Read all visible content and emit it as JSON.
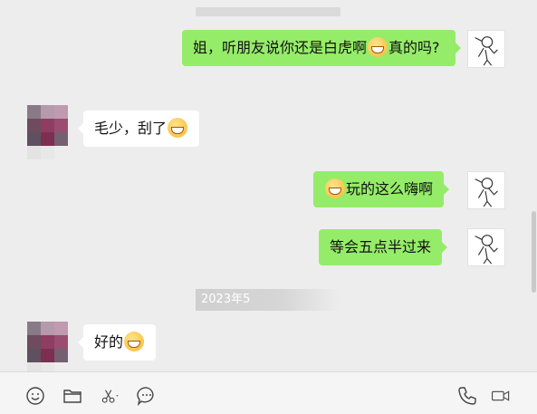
{
  "messages": [
    {
      "side": "self",
      "text_before": "姐，听朋友说你还是白虎啊",
      "emoji": "laugh-cry-emoji",
      "text_after": "真的吗?"
    },
    {
      "side": "other",
      "text": "毛少，刮了",
      "emoji": "grin-emoji"
    },
    {
      "side": "self",
      "emoji": "laugh-cry-emoji",
      "text": "玩的这么嗨啊"
    },
    {
      "side": "self",
      "text": "等会五点半过来"
    },
    {
      "side": "other",
      "text": "好的",
      "emoji": "grin-emoji"
    }
  ],
  "timestamp": "2023年5",
  "toolbar": {
    "left_icons": [
      "emoji-icon",
      "folder-icon",
      "scissors-icon",
      "chat-history-icon"
    ],
    "right_icons": [
      "phone-icon",
      "video-call-icon"
    ]
  },
  "colors": {
    "background": "#ededed",
    "self_bubble": "#95ec69",
    "other_bubble": "#ffffff"
  }
}
